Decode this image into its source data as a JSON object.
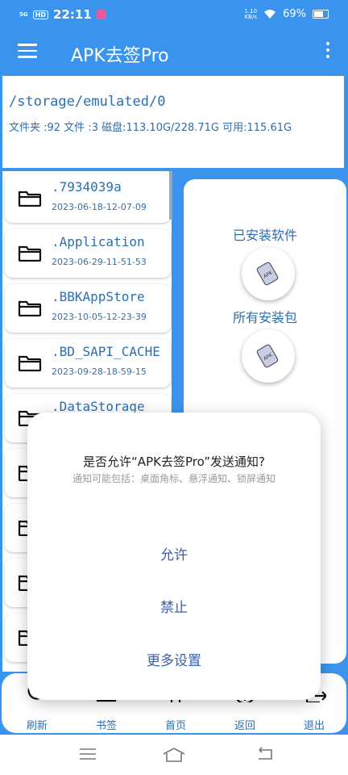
{
  "status_bar": {
    "signal": "5G",
    "hd_badge": "HD",
    "time": "22:11",
    "net_speed_value": "1.10",
    "net_speed_unit": "KB/s",
    "battery": "69%"
  },
  "app_bar": {
    "title": "APK去签Pro"
  },
  "path_panel": {
    "path": "/storage/emulated/0",
    "stats": "文件夹 :92    文件 :3    磁盘:113.10G/228.71G  可用:115.61G"
  },
  "files": [
    {
      "name": ".7934039a",
      "date": "2023-06-18-12-07-09"
    },
    {
      "name": ".Application",
      "date": "2023-06-29-11-51-53"
    },
    {
      "name": ".BBKAppStore",
      "date": "2023-10-05-12-23-39"
    },
    {
      "name": ".BD_SAPI_CACHE",
      "date": "2023-09-28-18-59-15"
    },
    {
      "name": ".DataStorage",
      "date": ""
    }
  ],
  "right_panel": {
    "installed_label": "已安装软件",
    "packages_label": "所有安装包",
    "apk_text": "APK"
  },
  "bottom_nav": {
    "refresh": "刷新",
    "bookmark": "书签",
    "home": "首页",
    "back": "返回",
    "exit": "退出"
  },
  "dialog": {
    "title": "是否允许“APK去签Pro”发送通知?",
    "subtitle": "通知可能包括：桌面角标、悬浮通知、锁屏通知",
    "allow": "允许",
    "deny": "禁止",
    "more": "更多设置"
  },
  "colors": {
    "primary": "#3a94ee",
    "text_blue": "#2c6fb0",
    "dialog_button": "#3a5fae"
  }
}
